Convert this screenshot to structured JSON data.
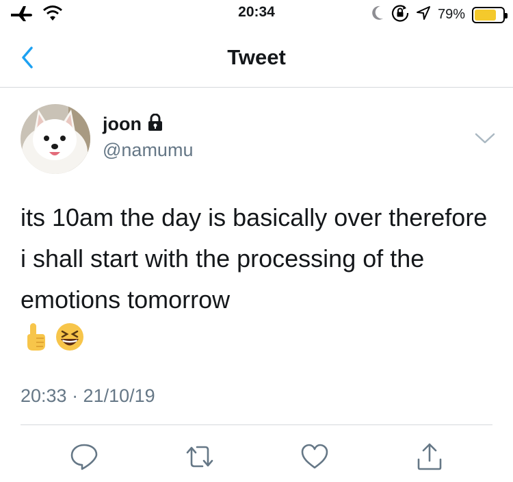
{
  "status_bar": {
    "time": "20:34",
    "battery_percent_text": "79%",
    "battery_level": 0.79,
    "icons": [
      "airplane-icon",
      "wifi-icon",
      "moon-icon",
      "orientation-lock-icon",
      "location-icon",
      "battery-icon"
    ]
  },
  "nav": {
    "title": "Tweet",
    "back_icon": "chevron-left-icon"
  },
  "tweet": {
    "display_name": "joon",
    "protected_icon": "lock-icon",
    "handle": "@namumu",
    "text": "its 10am the day is basically over therefore i shall start with the processing of the emotions tomorrow",
    "emojis": [
      "☝",
      "😆"
    ],
    "timestamp": "20:33 · 21/10/19",
    "menu_icon": "chevron-down-icon"
  },
  "actions": [
    {
      "name": "reply",
      "icon": "reply-icon"
    },
    {
      "name": "retweet",
      "icon": "retweet-icon"
    },
    {
      "name": "like",
      "icon": "heart-icon"
    },
    {
      "name": "share",
      "icon": "share-icon"
    }
  ],
  "colors": {
    "accent": "#1da1f2",
    "secondary_text": "#657786",
    "action_icon": "#657786",
    "divider": "#d5d8db",
    "battery_fill": "#f4c92c"
  }
}
